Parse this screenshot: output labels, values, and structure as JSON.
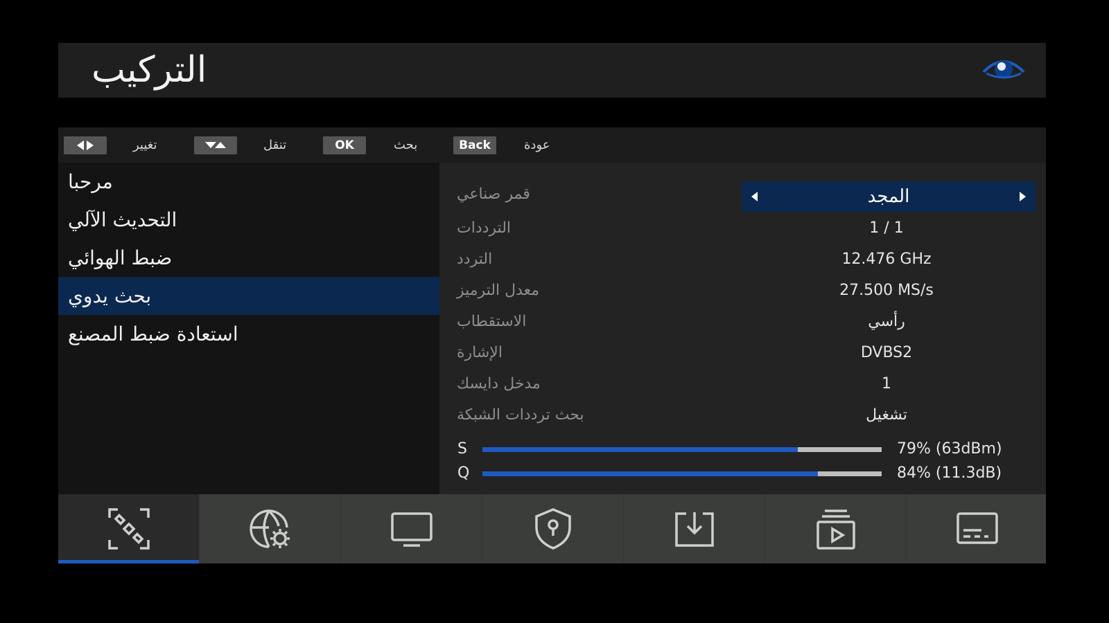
{
  "header": {
    "title": "التركيب",
    "logo_icon": "broadcaster-eye-logo"
  },
  "hints": [
    {
      "key_icon": "left-right-arrows-icon",
      "label": "تغيير"
    },
    {
      "key_icon": "up-down-arrows-icon",
      "label": "تنقل"
    },
    {
      "key": "OK",
      "label": "بحث"
    },
    {
      "key": "Back",
      "label": "عودة"
    }
  ],
  "menu": {
    "items": [
      {
        "label": "مرحبا"
      },
      {
        "label": "التحديث الآلي"
      },
      {
        "label": "ضبط الهوائي"
      },
      {
        "label": "بحث يدوي",
        "active": true
      },
      {
        "label": "استعادة ضبط المصنع"
      }
    ]
  },
  "settings": {
    "satellite": {
      "label": "قمر صناعي",
      "value": "المجد"
    },
    "transponders": {
      "label": "الترددات",
      "value": "1 / 1"
    },
    "frequency": {
      "label": "التردد",
      "value": "12.476 GHz"
    },
    "symbol_rate": {
      "label": "معدل الترميز",
      "value": "27.500 MS/s"
    },
    "polarization": {
      "label": "الاستقطاب",
      "value": "رأسي"
    },
    "signal": {
      "label": "الإشارة",
      "value": "DVBS2"
    },
    "diseqc": {
      "label": "مدخل دايسك",
      "value": "1"
    },
    "network_search": {
      "label": "بحث ترددات الشبكة",
      "value": "تشغيل"
    }
  },
  "signal_meters": {
    "strength": {
      "letter": "S",
      "percent": 79,
      "readout": "79% (63dBm)"
    },
    "quality": {
      "letter": "Q",
      "percent": 84,
      "readout": "84% (11.3dB)"
    }
  },
  "tabs": [
    {
      "icon": "satellite-icon",
      "active": true
    },
    {
      "icon": "globe-gear-icon"
    },
    {
      "icon": "monitor-icon"
    },
    {
      "icon": "shield-lock-icon"
    },
    {
      "icon": "download-icon"
    },
    {
      "icon": "media-play-icon"
    },
    {
      "icon": "subtitles-icon"
    }
  ],
  "colors": {
    "accent": "#1e5bc0",
    "selection": "#0b2851",
    "bar_track": "#bdbdbd"
  }
}
